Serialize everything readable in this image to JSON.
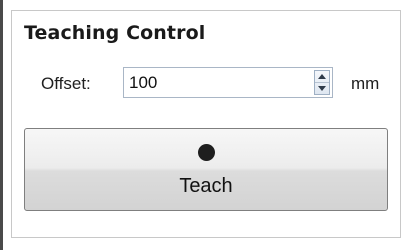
{
  "panel": {
    "title": "Teaching Control"
  },
  "offset": {
    "label": "Offset:",
    "value": "100",
    "unit": "mm"
  },
  "teach_button": {
    "icon": "record-dot-icon",
    "label": "Teach"
  }
}
